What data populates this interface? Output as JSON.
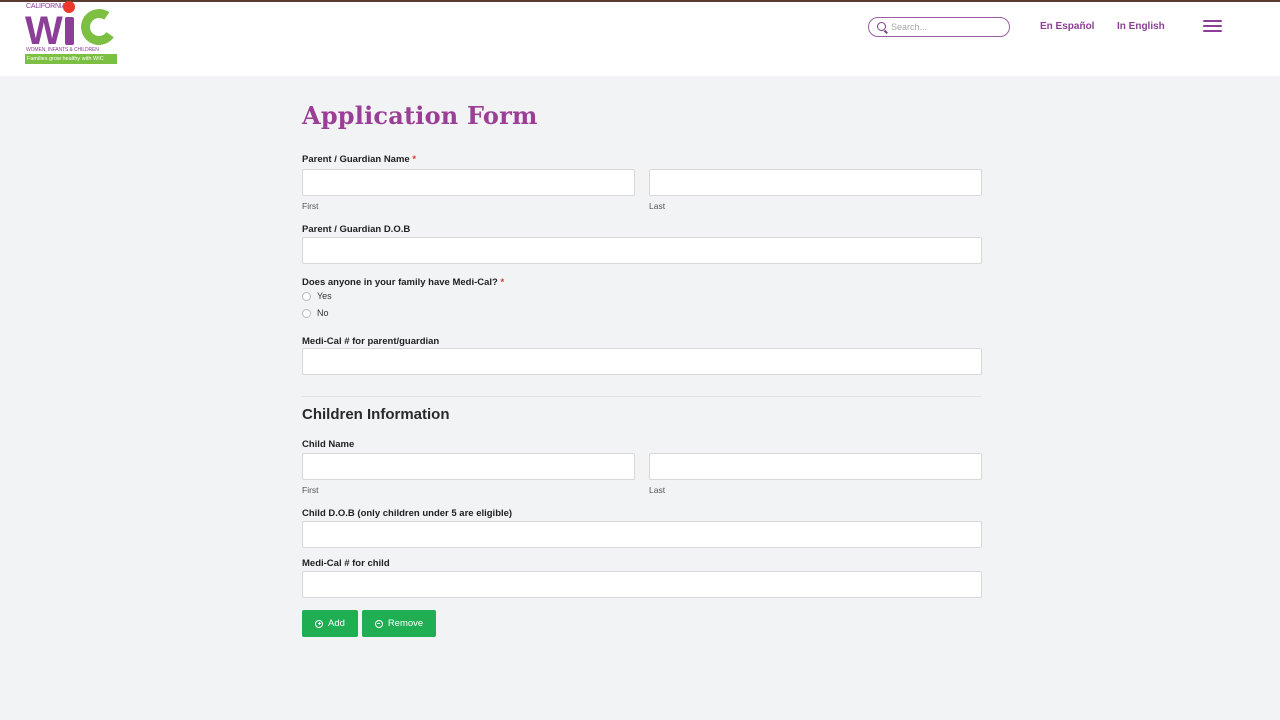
{
  "header": {
    "logo": {
      "state": "CALIFORNIA",
      "letters": "WIC",
      "subtitle": "WOMEN, INFANTS & CHILDREN",
      "tagline": "Families grow healthy with WIC"
    },
    "search": {
      "placeholder": "Search..."
    },
    "lang_es": "En Español",
    "lang_en": "In English"
  },
  "form": {
    "title": "Application Form",
    "parent_name_label": "Parent / Guardian Name",
    "required_mark": "*",
    "first_label": "First",
    "last_label": "Last",
    "parent_dob_label": "Parent / Guardian D.O.B",
    "medical_question": "Does anyone in your family have Medi-Cal?",
    "options": {
      "yes": "Yes",
      "no": "No"
    },
    "medical_parent_label": "Medi-Cal # for parent/guardian",
    "children_heading": "Children Information",
    "child_name_label": "Child Name",
    "child_first_label": "First",
    "child_last_label": "Last",
    "child_dob_label": "Child D.O.B (only children under 5 are eligible)",
    "medical_child_label": "Medi-Cal # for child",
    "add_label": "Add",
    "remove_label": "Remove"
  },
  "colors": {
    "brand_purple": "#8b3f96",
    "brand_green": "#7cbf43",
    "brand_red": "#e8392c",
    "button_green": "#1fae52",
    "page_bg": "#f2f3f5"
  }
}
